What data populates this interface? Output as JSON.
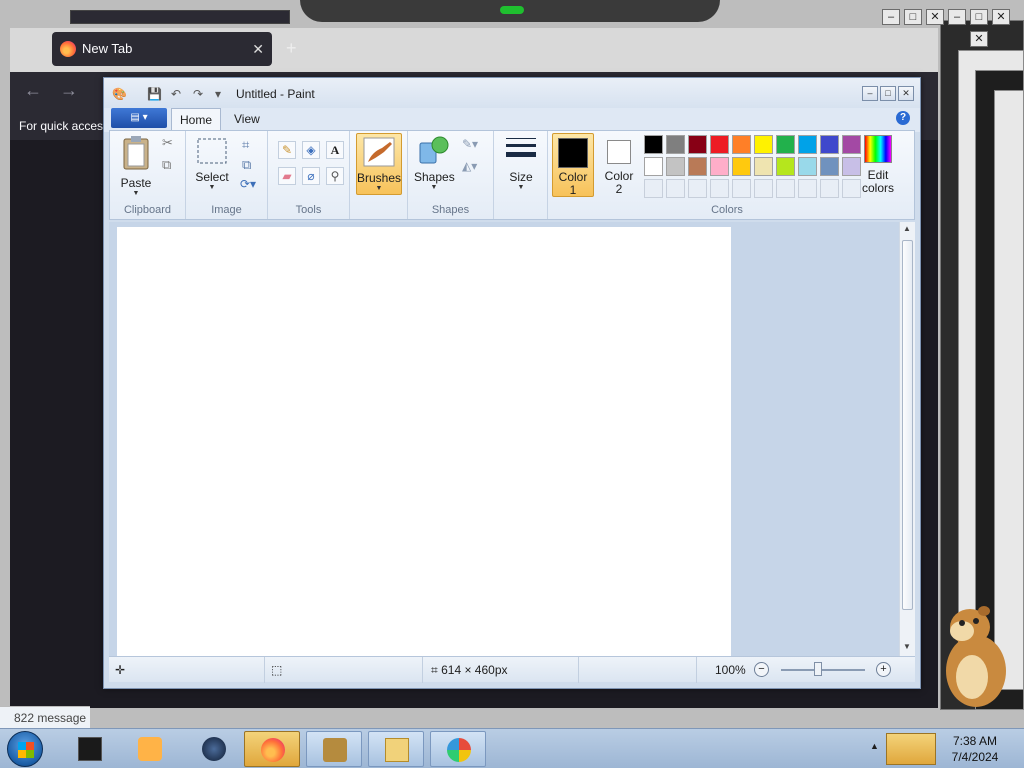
{
  "firefox": {
    "tab_title": "New Tab",
    "tab_close": "✕",
    "new_tab": "+",
    "back": "←",
    "forward": "→",
    "bookmarks_text": "For quick access"
  },
  "paint": {
    "title": "Untitled - Paint",
    "qat_dropdown": "▾",
    "tabs": {
      "file": "▤ ▾",
      "home": "Home",
      "view": "View"
    },
    "help": "?",
    "groups": {
      "clipboard": {
        "label": "Clipboard",
        "paste": "Paste"
      },
      "image": {
        "label": "Image",
        "select": "Select"
      },
      "tools": {
        "label": "Tools"
      },
      "brushes": {
        "label": "Brushes"
      },
      "shapes": {
        "label": "Shapes",
        "shapes_btn": "Shapes"
      },
      "size": {
        "label": "Size"
      },
      "colors": {
        "label": "Colors",
        "color1": "Color 1",
        "color1_line1": "Color",
        "color1_line2": "1",
        "color2_line1": "Color",
        "color2_line2": "2",
        "edit_line1": "Edit",
        "edit_line2": "colors"
      }
    },
    "palette_row1": [
      "#000000",
      "#7f7f7f",
      "#880015",
      "#ed1c24",
      "#ff7f27",
      "#fff200",
      "#22b14c",
      "#00a2e8",
      "#3f48cc",
      "#a349a4"
    ],
    "palette_row2": [
      "#ffffff",
      "#c3c3c3",
      "#b97a57",
      "#ffaec9",
      "#ffc90e",
      "#efe4b0",
      "#b5e61d",
      "#99d9ea",
      "#7092be",
      "#c8bfe7"
    ],
    "status": {
      "canvas_size": "614 × 460px",
      "zoom": "100%",
      "zoom_out": "−",
      "zoom_in": "+"
    }
  },
  "desktop": {
    "message_count": "822 message"
  },
  "taskbar": {
    "time": "7:38 AM",
    "date": "7/4/2024"
  }
}
